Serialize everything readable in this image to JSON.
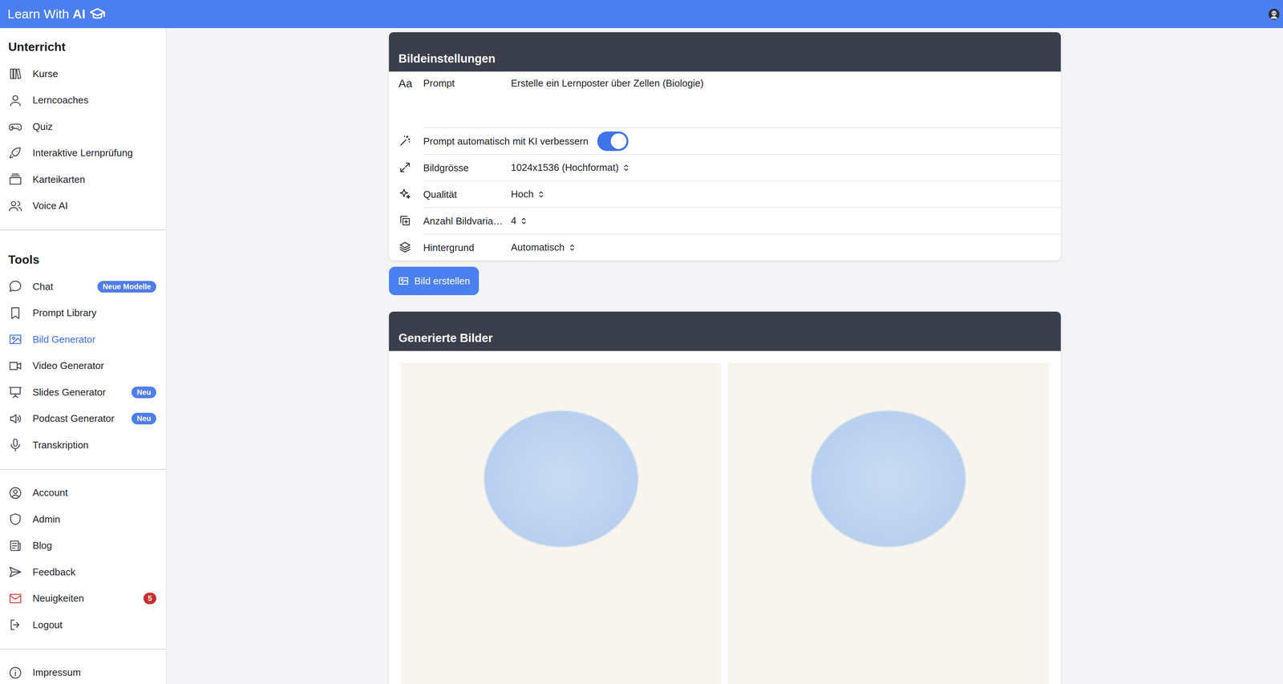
{
  "app": {
    "title": "Learn With",
    "title_emphasis": "AI"
  },
  "sidebar": {
    "sections": [
      {
        "heading": "Unterricht",
        "items": [
          {
            "label": "Kurse",
            "selected": false
          },
          {
            "label": "Lerncoaches",
            "selected": false
          },
          {
            "label": "Quiz",
            "selected": false
          },
          {
            "label": "Interaktive Lernprüfung",
            "selected": false
          },
          {
            "label": "Karteikarten",
            "selected": false
          },
          {
            "label": "Voice AI",
            "selected": false
          }
        ]
      },
      {
        "heading": "Tools",
        "items": [
          {
            "label": "Chat",
            "selected": false,
            "badge": "Neue Modelle",
            "badge_color": "#4f7de9"
          },
          {
            "label": "Prompt Library",
            "selected": false
          },
          {
            "label": "Bild Generator",
            "selected": true
          },
          {
            "label": "Video Generator",
            "selected": false
          },
          {
            "label": "Slides Generator",
            "selected": false,
            "badge": "Neu",
            "badge_color": "#4f7de9"
          },
          {
            "label": "Podcast Generator",
            "selected": false,
            "badge": "Neu",
            "badge_color": "#4f7de9"
          },
          {
            "label": "Transkription",
            "selected": false
          }
        ]
      },
      {
        "items": [
          {
            "label": "Account",
            "selected": false
          },
          {
            "label": "Admin",
            "selected": false
          },
          {
            "label": "Blog",
            "selected": false
          },
          {
            "label": "Feedback",
            "selected": false
          },
          {
            "label": "Neuigkeiten",
            "selected": false,
            "badge": "5",
            "badge_color": "#c8302f",
            "color": "#d23a36"
          },
          {
            "label": "Logout",
            "selected": false
          }
        ]
      },
      {
        "items": [
          {
            "label": "Impressum",
            "selected": false
          }
        ]
      }
    ]
  },
  "settings": {
    "title": "Bildeinstellungen",
    "rows": [
      {
        "kind": "textarea",
        "icon": "Aa",
        "label": "Prompt",
        "value": "Erstelle ein Lernposter über Zellen (Biologie)"
      },
      {
        "kind": "toggle",
        "label": "Prompt automatisch mit KI verbessern",
        "on": true
      },
      {
        "kind": "select",
        "label": "Bildgrösse",
        "value": "1024x1536 (Hochformat)"
      },
      {
        "kind": "select",
        "label": "Qualität",
        "value": "Hoch"
      },
      {
        "kind": "select",
        "label": "Anzahl Bildvaria…",
        "value": "4"
      },
      {
        "kind": "select",
        "label": "Hintergrund",
        "value": "Automatisch"
      }
    ]
  },
  "create_button": {
    "label": "Bild erstellen"
  },
  "gallery": {
    "title": "Generierte Bilder"
  }
}
